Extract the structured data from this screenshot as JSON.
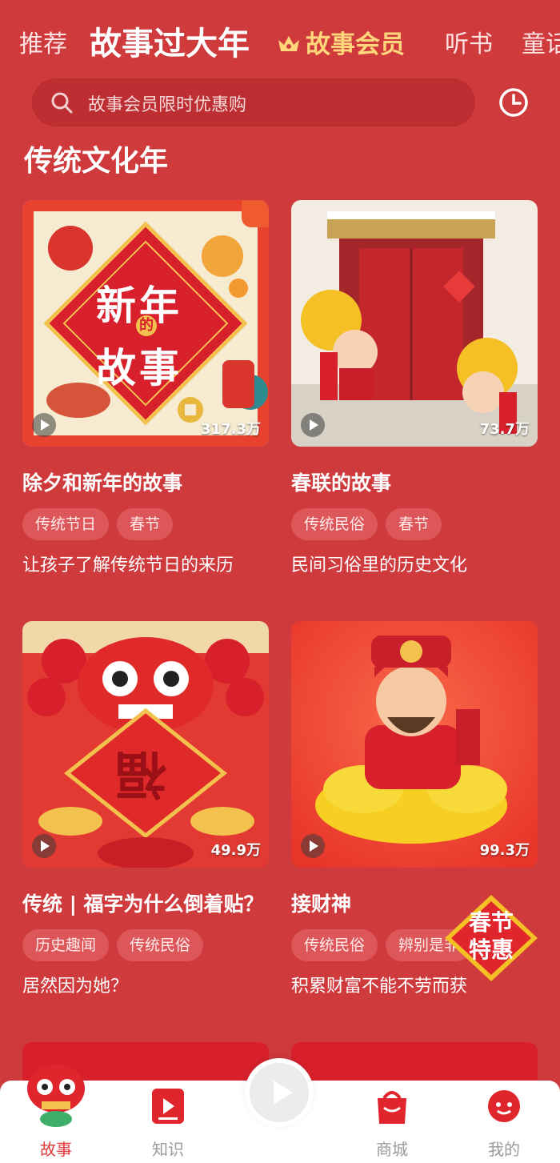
{
  "top_tabs": {
    "recommend": "推荐",
    "active": "故事过大年",
    "vip": "故事会员",
    "listen": "听书",
    "fairy": "童话"
  },
  "search": {
    "placeholder": "故事会员限时优惠购"
  },
  "section_title": "传统文化年",
  "cards": [
    {
      "thumb_text_1": "新年",
      "thumb_text_small": "的",
      "thumb_text_2": "故事",
      "count": "317.3万",
      "title": "除夕和新年的故事",
      "tags": [
        "传统节日",
        "春节"
      ],
      "desc": "让孩子了解传统节日的来历"
    },
    {
      "count": "73.7万",
      "title": "春联的故事",
      "tags": [
        "传统民俗",
        "春节"
      ],
      "desc": "民间习俗里的历史文化"
    },
    {
      "count": "49.9万",
      "title": "传统 | 福字为什么倒着贴？",
      "tags": [
        "历史趣闻",
        "传统民俗"
      ],
      "desc": "居然因为她？"
    },
    {
      "count": "99.3万",
      "title": "接财神",
      "tags": [
        "传统民俗",
        "辨别是非"
      ],
      "desc": "积累财富不能不劳而获"
    }
  ],
  "promo": {
    "line1": "春节",
    "line2": "特惠"
  },
  "bottom_nav": [
    {
      "label": "故事",
      "icon": "lion-dance-icon",
      "active": true
    },
    {
      "label": "知识",
      "icon": "video-play-icon",
      "active": false
    },
    {
      "label": "",
      "icon": "player-icon",
      "active": false
    },
    {
      "label": "商城",
      "icon": "shop-bag-icon",
      "active": false
    },
    {
      "label": "我的",
      "icon": "profile-icon",
      "active": false
    }
  ],
  "colors": {
    "background": "#cf3a3d",
    "vip_gold": "#ffd77a",
    "nav_active": "#e33a3c"
  }
}
